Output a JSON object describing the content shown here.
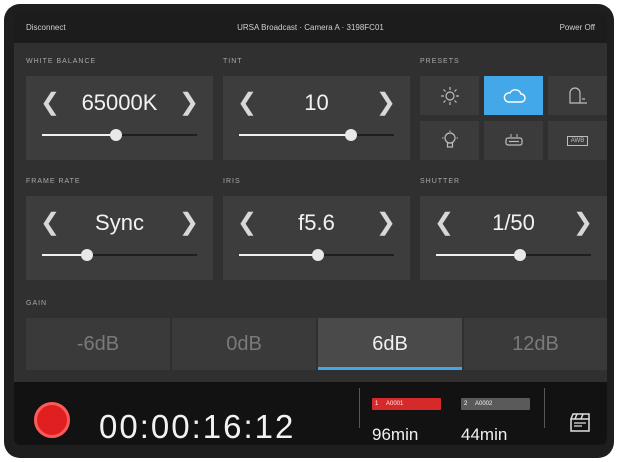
{
  "topbar": {
    "left": "Disconnect",
    "center": "URSA Broadcast · Camera A · 3198FC01",
    "right": "Power Off"
  },
  "sections": {
    "white_balance": "WHITE BALANCE",
    "tint": "TINT",
    "presets": "PRESETS",
    "frame_rate": "FRAME RATE",
    "iris": "IRIS",
    "shutter": "SHUTTER",
    "gain": "GAIN"
  },
  "controls": {
    "white_balance": {
      "value": "65000K",
      "level": 0.48
    },
    "tint": {
      "value": "10",
      "level": 0.72
    },
    "frame_rate": {
      "value": "Sync",
      "level": 0.29
    },
    "iris": {
      "value": "f5.6",
      "level": 0.51
    },
    "shutter": {
      "value": "1/50",
      "level": 0.54
    }
  },
  "presets": {
    "items": [
      {
        "name": "sun-icon",
        "active": false
      },
      {
        "name": "cloud-icon",
        "active": true
      },
      {
        "name": "shade-icon",
        "active": false
      },
      {
        "name": "bulb-icon",
        "active": false
      },
      {
        "name": "fluorescent-icon",
        "active": false
      },
      {
        "name": "custom-preset-icon",
        "active": false
      }
    ],
    "custom_label": "AWB"
  },
  "gain": {
    "options": [
      "-6dB",
      "0dB",
      "6dB",
      "12dB"
    ],
    "selected_index": 2
  },
  "record": {
    "timecode": "00:00:16:12"
  },
  "media": [
    {
      "slot": "1",
      "label": "A0001",
      "time": "96min",
      "color": "#d62a2a"
    },
    {
      "slot": "2",
      "label": "A0002",
      "time": "44min",
      "color": "#5a5a5a"
    }
  ],
  "colors": {
    "accent": "#43a8e8",
    "record": "#e02020"
  }
}
